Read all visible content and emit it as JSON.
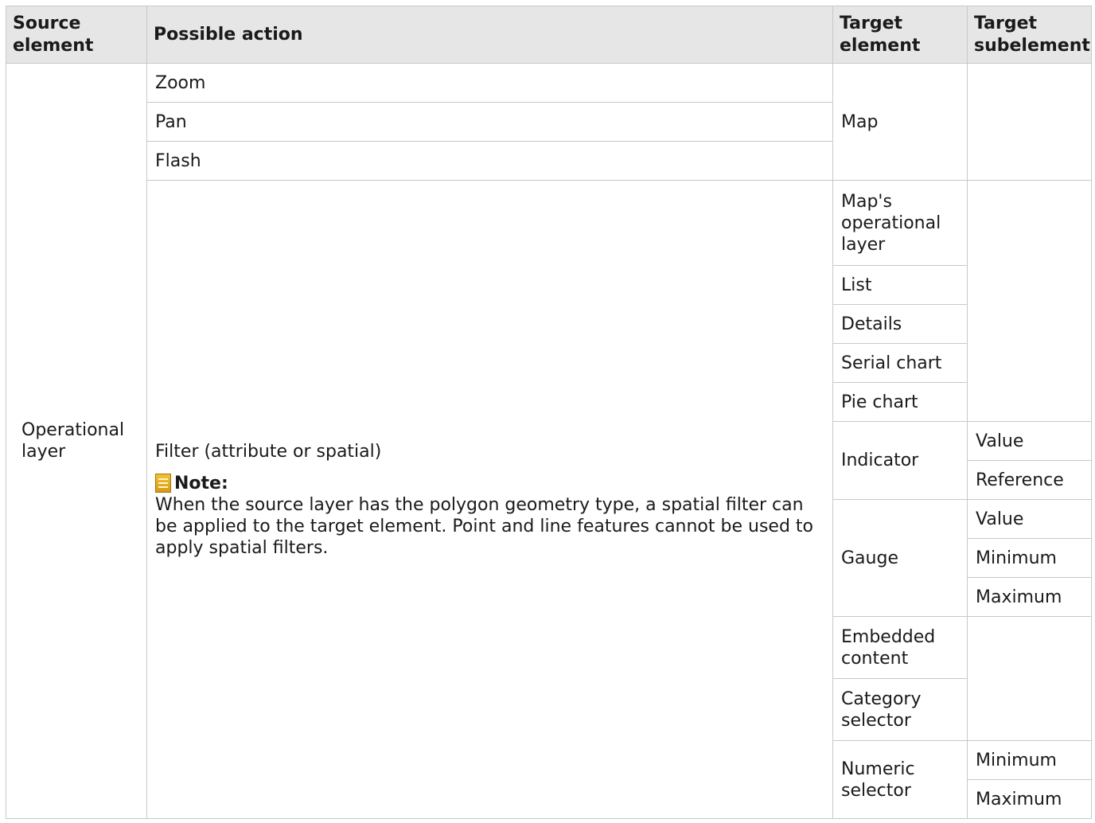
{
  "headers": {
    "source_element": "Source element",
    "possible_action": "Possible action",
    "target_element": "Target element",
    "target_subelement": "Target subelement"
  },
  "source": "Operational layer",
  "actions": {
    "zoom": "Zoom",
    "pan": "Pan",
    "flash": "Flash",
    "filter": "Filter (attribute or spatial)",
    "note_label": "Note:",
    "note_text": "When the source layer has the polygon geometry type, a spatial filter can be applied to the target element. Point and line features cannot be used to apply spatial filters."
  },
  "targets": {
    "map": "Map",
    "maps_operational_layer": "Map's operational layer",
    "list": "List",
    "details": "Details",
    "serial_chart": "Serial chart",
    "pie_chart": "Pie chart",
    "indicator": "Indicator",
    "gauge": "Gauge",
    "embedded_content": "Embedded content",
    "category_selector": "Category selector",
    "numeric_selector": "Numeric selector"
  },
  "subelements": {
    "indicator_value": "Value",
    "indicator_reference": "Reference",
    "gauge_value": "Value",
    "gauge_minimum": "Minimum",
    "gauge_maximum": "Maximum",
    "numeric_minimum": "Minimum",
    "numeric_maximum": "Maximum"
  },
  "icons": {
    "note": "note-icon"
  }
}
